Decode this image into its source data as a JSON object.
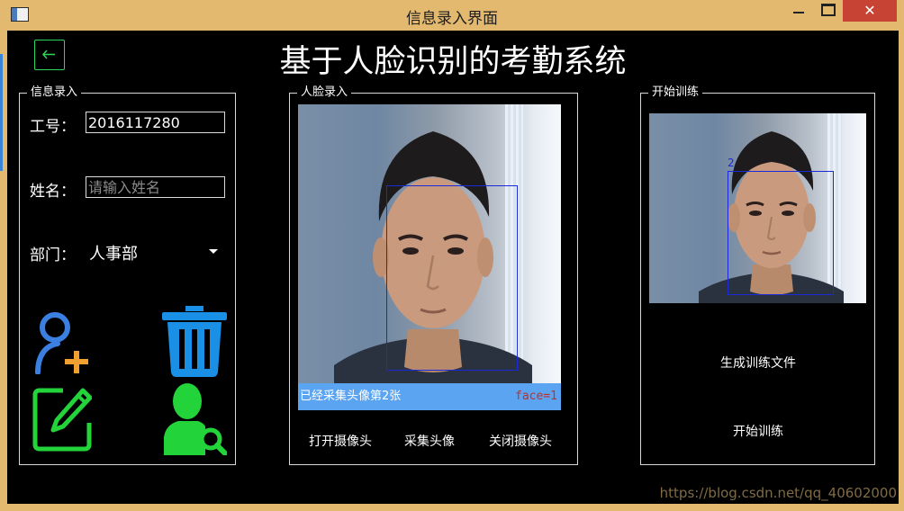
{
  "window": {
    "title": "信息录入界面",
    "close_glyph": "✕"
  },
  "header": {
    "title": "基于人脸识别的考勤系统"
  },
  "info_panel": {
    "title": "信息录入",
    "id_label": "工号：",
    "id_value": "2016117280",
    "name_label": "姓名：",
    "name_placeholder": "请输入姓名",
    "dept_label": "部门：",
    "dept_value": "人事部",
    "icons": [
      "add-user-icon",
      "trash-icon",
      "edit-icon",
      "search-user-icon"
    ],
    "colors": {
      "add_user": "#3b7fe0",
      "plus": "#f0a030",
      "trash": "#1a8fe6",
      "green": "#22d33a"
    }
  },
  "face_panel": {
    "title": "人脸录入",
    "status_text": "已经采集头像第2张",
    "face_count_text": "face=1",
    "buttons": [
      "打开摄像头",
      "采集头像",
      "关闭摄像头"
    ]
  },
  "train_panel": {
    "title": "开始训练",
    "box_label": "2",
    "buttons": [
      "生成训练文件",
      "开始训练"
    ]
  },
  "watermark": "https://blog.csdn.net/qq_40602000"
}
